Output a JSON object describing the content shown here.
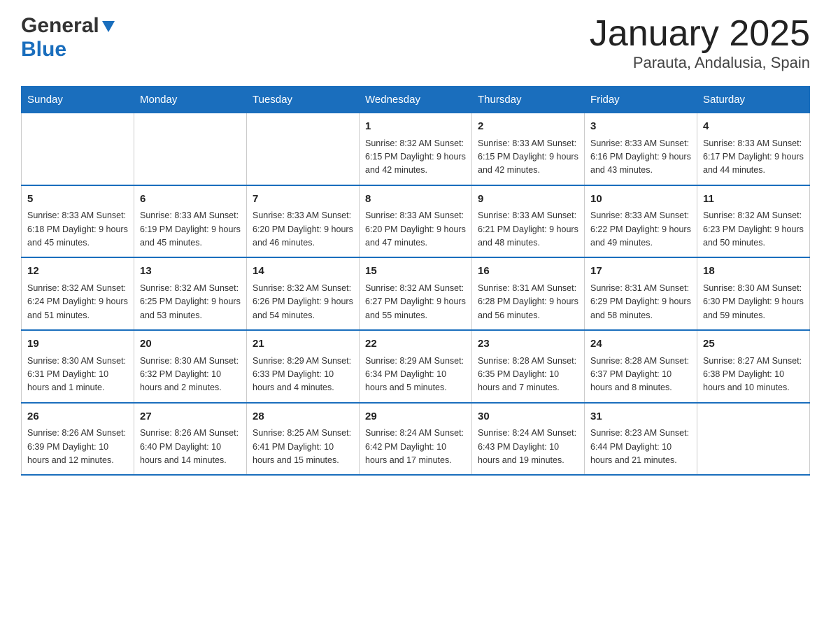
{
  "header": {
    "logo_general": "General",
    "logo_blue": "Blue",
    "title": "January 2025",
    "subtitle": "Parauta, Andalusia, Spain"
  },
  "calendar": {
    "days_of_week": [
      "Sunday",
      "Monday",
      "Tuesday",
      "Wednesday",
      "Thursday",
      "Friday",
      "Saturday"
    ],
    "weeks": [
      [
        {
          "day": "",
          "info": ""
        },
        {
          "day": "",
          "info": ""
        },
        {
          "day": "",
          "info": ""
        },
        {
          "day": "1",
          "info": "Sunrise: 8:32 AM\nSunset: 6:15 PM\nDaylight: 9 hours\nand 42 minutes."
        },
        {
          "day": "2",
          "info": "Sunrise: 8:33 AM\nSunset: 6:15 PM\nDaylight: 9 hours\nand 42 minutes."
        },
        {
          "day": "3",
          "info": "Sunrise: 8:33 AM\nSunset: 6:16 PM\nDaylight: 9 hours\nand 43 minutes."
        },
        {
          "day": "4",
          "info": "Sunrise: 8:33 AM\nSunset: 6:17 PM\nDaylight: 9 hours\nand 44 minutes."
        }
      ],
      [
        {
          "day": "5",
          "info": "Sunrise: 8:33 AM\nSunset: 6:18 PM\nDaylight: 9 hours\nand 45 minutes."
        },
        {
          "day": "6",
          "info": "Sunrise: 8:33 AM\nSunset: 6:19 PM\nDaylight: 9 hours\nand 45 minutes."
        },
        {
          "day": "7",
          "info": "Sunrise: 8:33 AM\nSunset: 6:20 PM\nDaylight: 9 hours\nand 46 minutes."
        },
        {
          "day": "8",
          "info": "Sunrise: 8:33 AM\nSunset: 6:20 PM\nDaylight: 9 hours\nand 47 minutes."
        },
        {
          "day": "9",
          "info": "Sunrise: 8:33 AM\nSunset: 6:21 PM\nDaylight: 9 hours\nand 48 minutes."
        },
        {
          "day": "10",
          "info": "Sunrise: 8:33 AM\nSunset: 6:22 PM\nDaylight: 9 hours\nand 49 minutes."
        },
        {
          "day": "11",
          "info": "Sunrise: 8:32 AM\nSunset: 6:23 PM\nDaylight: 9 hours\nand 50 minutes."
        }
      ],
      [
        {
          "day": "12",
          "info": "Sunrise: 8:32 AM\nSunset: 6:24 PM\nDaylight: 9 hours\nand 51 minutes."
        },
        {
          "day": "13",
          "info": "Sunrise: 8:32 AM\nSunset: 6:25 PM\nDaylight: 9 hours\nand 53 minutes."
        },
        {
          "day": "14",
          "info": "Sunrise: 8:32 AM\nSunset: 6:26 PM\nDaylight: 9 hours\nand 54 minutes."
        },
        {
          "day": "15",
          "info": "Sunrise: 8:32 AM\nSunset: 6:27 PM\nDaylight: 9 hours\nand 55 minutes."
        },
        {
          "day": "16",
          "info": "Sunrise: 8:31 AM\nSunset: 6:28 PM\nDaylight: 9 hours\nand 56 minutes."
        },
        {
          "day": "17",
          "info": "Sunrise: 8:31 AM\nSunset: 6:29 PM\nDaylight: 9 hours\nand 58 minutes."
        },
        {
          "day": "18",
          "info": "Sunrise: 8:30 AM\nSunset: 6:30 PM\nDaylight: 9 hours\nand 59 minutes."
        }
      ],
      [
        {
          "day": "19",
          "info": "Sunrise: 8:30 AM\nSunset: 6:31 PM\nDaylight: 10 hours\nand 1 minute."
        },
        {
          "day": "20",
          "info": "Sunrise: 8:30 AM\nSunset: 6:32 PM\nDaylight: 10 hours\nand 2 minutes."
        },
        {
          "day": "21",
          "info": "Sunrise: 8:29 AM\nSunset: 6:33 PM\nDaylight: 10 hours\nand 4 minutes."
        },
        {
          "day": "22",
          "info": "Sunrise: 8:29 AM\nSunset: 6:34 PM\nDaylight: 10 hours\nand 5 minutes."
        },
        {
          "day": "23",
          "info": "Sunrise: 8:28 AM\nSunset: 6:35 PM\nDaylight: 10 hours\nand 7 minutes."
        },
        {
          "day": "24",
          "info": "Sunrise: 8:28 AM\nSunset: 6:37 PM\nDaylight: 10 hours\nand 8 minutes."
        },
        {
          "day": "25",
          "info": "Sunrise: 8:27 AM\nSunset: 6:38 PM\nDaylight: 10 hours\nand 10 minutes."
        }
      ],
      [
        {
          "day": "26",
          "info": "Sunrise: 8:26 AM\nSunset: 6:39 PM\nDaylight: 10 hours\nand 12 minutes."
        },
        {
          "day": "27",
          "info": "Sunrise: 8:26 AM\nSunset: 6:40 PM\nDaylight: 10 hours\nand 14 minutes."
        },
        {
          "day": "28",
          "info": "Sunrise: 8:25 AM\nSunset: 6:41 PM\nDaylight: 10 hours\nand 15 minutes."
        },
        {
          "day": "29",
          "info": "Sunrise: 8:24 AM\nSunset: 6:42 PM\nDaylight: 10 hours\nand 17 minutes."
        },
        {
          "day": "30",
          "info": "Sunrise: 8:24 AM\nSunset: 6:43 PM\nDaylight: 10 hours\nand 19 minutes."
        },
        {
          "day": "31",
          "info": "Sunrise: 8:23 AM\nSunset: 6:44 PM\nDaylight: 10 hours\nand 21 minutes."
        },
        {
          "day": "",
          "info": ""
        }
      ]
    ]
  }
}
